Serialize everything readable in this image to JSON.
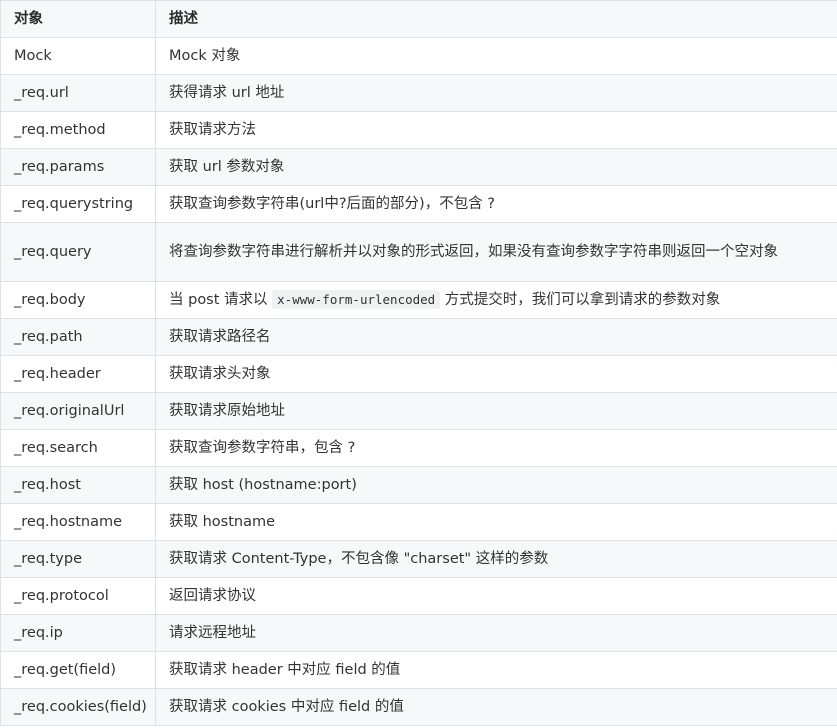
{
  "table": {
    "headers": {
      "object": "对象",
      "description": "描述"
    },
    "rows": [
      {
        "object": "Mock",
        "description": "Mock 对象"
      },
      {
        "object": "_req.url",
        "description": "获得请求 url 地址"
      },
      {
        "object": "_req.method",
        "description": "获取请求方法"
      },
      {
        "object": "_req.params",
        "description": "获取 url 参数对象"
      },
      {
        "object": "_req.querystring",
        "description": "获取查询参数字符串(url中?后面的部分)，不包含 ?"
      },
      {
        "object": "_req.query",
        "description": "将查询参数字符串进行解析并以对象的形式返回，如果没有查询参数字字符串则返回一个空对象"
      },
      {
        "object": "_req.body",
        "description_before": "当 post 请求以 ",
        "description_code": "x-www-form-urlencoded",
        "description_after": " 方式提交时，我们可以拿到请求的参数对象"
      },
      {
        "object": "_req.path",
        "description": "获取请求路径名"
      },
      {
        "object": "_req.header",
        "description": "获取请求头对象"
      },
      {
        "object": "_req.originalUrl",
        "description": "获取请求原始地址"
      },
      {
        "object": "_req.search",
        "description": "获取查询参数字符串，包含 ?"
      },
      {
        "object": "_req.host",
        "description": "获取 host (hostname:port)"
      },
      {
        "object": "_req.hostname",
        "description": "获取 hostname"
      },
      {
        "object": "_req.type",
        "description": "获取请求 Content-Type，不包含像 \"charset\" 这样的参数"
      },
      {
        "object": "_req.protocol",
        "description": "返回请求协议"
      },
      {
        "object": "_req.ip",
        "description": "请求远程地址"
      },
      {
        "object": "_req.get(field)",
        "description": "获取请求 header 中对应 field 的值"
      },
      {
        "object": "_req.cookies(field)",
        "description": "获取请求 cookies 中对应 field 的值"
      }
    ]
  }
}
